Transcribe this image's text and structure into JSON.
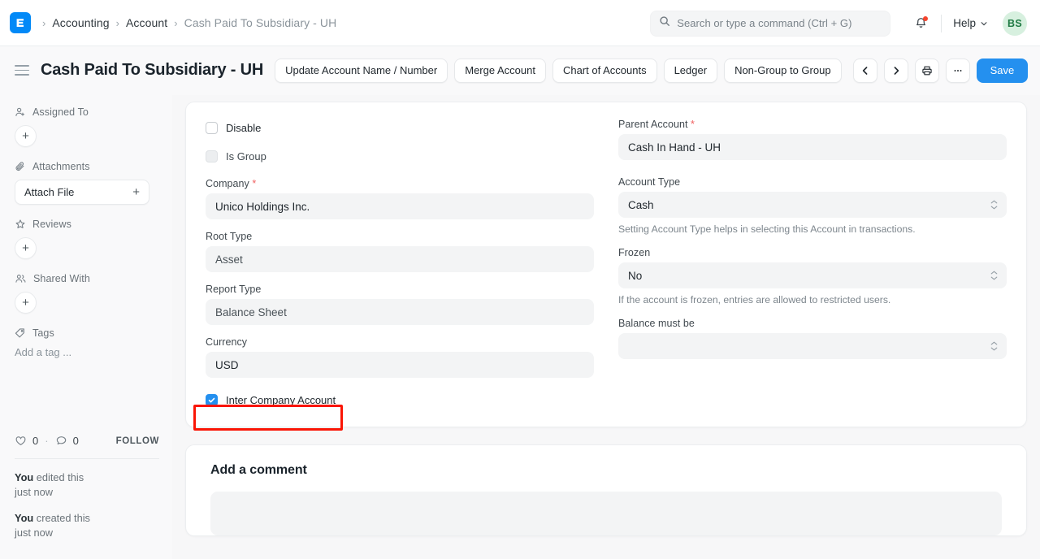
{
  "navbar": {
    "logo_icon": "erpnext-logo-icon",
    "breadcrumb": {
      "items": [
        {
          "label": "Accounting",
          "current": false
        },
        {
          "label": "Account",
          "current": false
        },
        {
          "label": "Cash Paid To Subsidiary - UH",
          "current": true
        }
      ],
      "separator": "›"
    },
    "search": {
      "placeholder": "Search or type a command (Ctrl + G)",
      "value": "",
      "icon": "search-icon"
    },
    "notifications": {
      "icon": "bell-icon",
      "has_unread": true,
      "badge_color": "#f5452e"
    },
    "help": {
      "label": "Help",
      "icon": "chevron-down-icon"
    },
    "avatar": {
      "initials": "BS",
      "bg": "#d7f0df",
      "fg": "#1f7a43"
    }
  },
  "page_head": {
    "menu_icon": "hamburger-icon",
    "title": "Cash Paid To Subsidiary - UH",
    "buttons": [
      {
        "label": "Update Account Name / Number"
      },
      {
        "label": "Merge Account"
      },
      {
        "label": "Chart of Accounts"
      },
      {
        "label": "Ledger"
      },
      {
        "label": "Non-Group to Group"
      }
    ],
    "prev_icon": "chevron-left-icon",
    "next_icon": "chevron-right-icon",
    "print_icon": "printer-icon",
    "more_icon": "ellipsis-icon",
    "save_label": "Save",
    "save_color": "#2490ef"
  },
  "sidebar": {
    "sections": [
      {
        "title": "Assigned To",
        "icon": "user-plus-icon",
        "control": "plus-circle",
        "plus": "+"
      },
      {
        "title": "Attachments",
        "icon": "paperclip-icon",
        "control": "attach-button",
        "button_label": "Attach File",
        "plus": "+"
      },
      {
        "title": "Reviews",
        "icon": "star-icon",
        "control": "plus-circle",
        "plus": "+"
      },
      {
        "title": "Shared With",
        "icon": "users-icon",
        "control": "plus-circle",
        "plus": "+"
      },
      {
        "title": "Tags",
        "icon": "tag-icon",
        "control": "tag-input",
        "placeholder": "Add a tag ..."
      }
    ],
    "footer": {
      "like_icon": "heart-icon",
      "like_count": "0",
      "separator": "·",
      "comment_icon": "comment-icon",
      "comment_count": "0",
      "follow_label": "FOLLOW",
      "activity": [
        {
          "actor": "You",
          "action": " edited this",
          "time": "just now"
        },
        {
          "actor": "You",
          "action": " created this",
          "time": "just now"
        }
      ]
    }
  },
  "form": {
    "left": {
      "disable": {
        "label": "Disable",
        "checked": false,
        "disabled": false
      },
      "is_group": {
        "label": "Is Group",
        "checked": false,
        "disabled": true
      },
      "company": {
        "label": "Company",
        "required": true,
        "value": "Unico Holdings Inc."
      },
      "root_type": {
        "label": "Root Type",
        "required": false,
        "value": "Asset"
      },
      "report_type": {
        "label": "Report Type",
        "required": false,
        "value": "Balance Sheet"
      },
      "currency": {
        "label": "Currency",
        "required": false,
        "value": "USD"
      },
      "inter_company": {
        "label": "Inter Company Account",
        "checked": true,
        "highlighted": true,
        "highlight_color": "#fa1505"
      }
    },
    "right": {
      "parent_account": {
        "label": "Parent Account",
        "required": true,
        "value": "Cash In Hand - UH"
      },
      "account_type": {
        "label": "Account Type",
        "required": false,
        "value": "Cash",
        "type": "select",
        "description": "Setting Account Type helps in selecting this Account in transactions."
      },
      "frozen": {
        "label": "Frozen",
        "required": false,
        "value": "No",
        "type": "select",
        "description": "If the account is frozen, entries are allowed to restricted users."
      },
      "balance_must_be": {
        "label": "Balance must be",
        "required": false,
        "value": "",
        "type": "select"
      }
    }
  },
  "comment": {
    "title": "Add a comment",
    "placeholder": ""
  }
}
